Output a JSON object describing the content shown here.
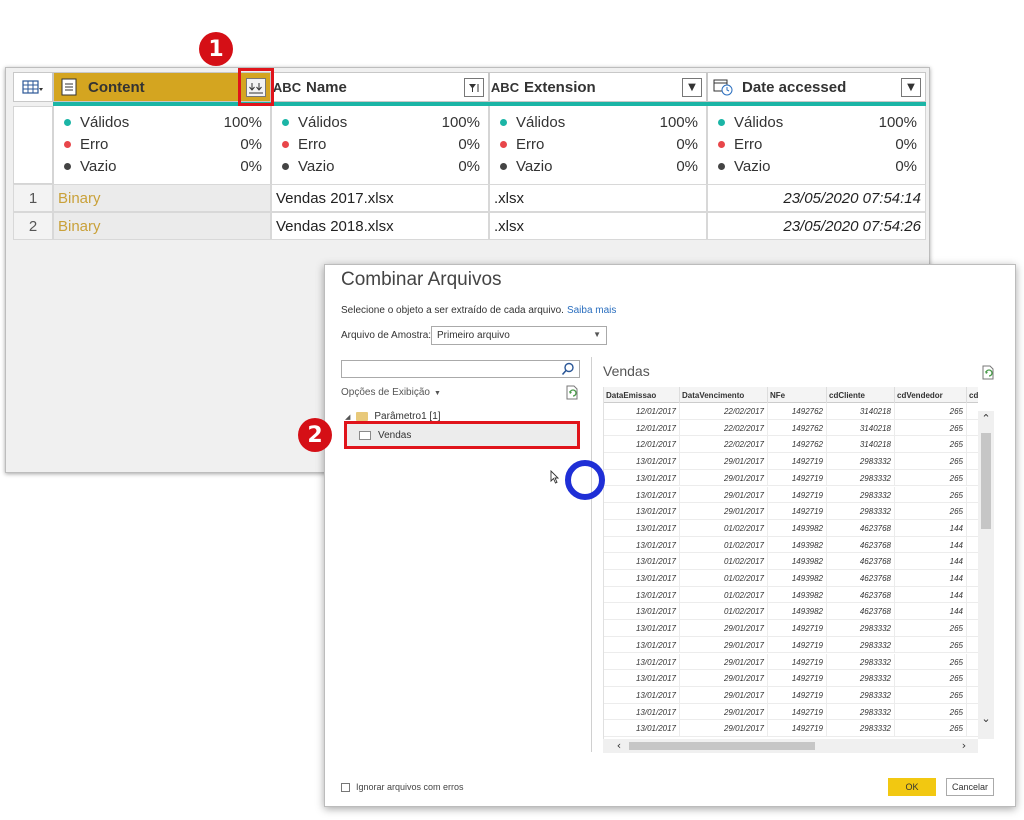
{
  "grid": {
    "columns": [
      {
        "name": "Content",
        "type_icon": "table-icon"
      },
      {
        "name": "Name",
        "type_icon": "ABC"
      },
      {
        "name": "Extension",
        "type_icon": "ABC"
      },
      {
        "name": "Date accessed",
        "type_icon": "date-icon"
      }
    ],
    "stats": {
      "valid_label": "Válidos",
      "error_label": "Erro",
      "empty_label": "Vazio",
      "valid_pct": "100%",
      "error_pct": "0%",
      "empty_pct": "0%"
    },
    "rows": [
      {
        "index": "1",
        "content": "Binary",
        "name": "Vendas 2017.xlsx",
        "extension": ".xlsx",
        "date": "23/05/2020 07:54:14"
      },
      {
        "index": "2",
        "content": "Binary",
        "name": "Vendas 2018.xlsx",
        "extension": ".xlsx",
        "date": "23/05/2020 07:54:26"
      }
    ],
    "colors": {
      "content_header": "#d4a520",
      "quality_bar": "#1bb5a6",
      "valid": "#1bb5a6",
      "error": "#e8464a",
      "empty": "#444444"
    }
  },
  "callouts": {
    "step1": "1",
    "step2": "2",
    "color": "#e0141b"
  },
  "dialog": {
    "title": "Combinar Arquivos",
    "description": "Selecione o objeto a ser extraído de cada arquivo.",
    "learn_more": "Saiba mais",
    "sample_label": "Arquivo de Amostra:",
    "sample_value": "Primeiro arquivo",
    "search_placeholder": "",
    "display_options": "Opções de Exibição",
    "tree": {
      "parameter": "Parâmetro1 [1]",
      "item": "Vendas"
    },
    "preview": {
      "title": "Vendas",
      "headers": [
        "DataEmissao",
        "DataVencimento",
        "NFe",
        "cdCliente",
        "cdVendedor",
        "cdProd"
      ],
      "rows": [
        [
          "12/01/2017",
          "22/02/2017",
          "1492762",
          "3140218",
          "265"
        ],
        [
          "12/01/2017",
          "22/02/2017",
          "1492762",
          "3140218",
          "265"
        ],
        [
          "12/01/2017",
          "22/02/2017",
          "1492762",
          "3140218",
          "265"
        ],
        [
          "13/01/2017",
          "29/01/2017",
          "1492719",
          "2983332",
          "265"
        ],
        [
          "13/01/2017",
          "29/01/2017",
          "1492719",
          "2983332",
          "265"
        ],
        [
          "13/01/2017",
          "29/01/2017",
          "1492719",
          "2983332",
          "265"
        ],
        [
          "13/01/2017",
          "29/01/2017",
          "1492719",
          "2983332",
          "265"
        ],
        [
          "13/01/2017",
          "01/02/2017",
          "1493982",
          "4623768",
          "144"
        ],
        [
          "13/01/2017",
          "01/02/2017",
          "1493982",
          "4623768",
          "144"
        ],
        [
          "13/01/2017",
          "01/02/2017",
          "1493982",
          "4623768",
          "144"
        ],
        [
          "13/01/2017",
          "01/02/2017",
          "1493982",
          "4623768",
          "144"
        ],
        [
          "13/01/2017",
          "01/02/2017",
          "1493982",
          "4623768",
          "144"
        ],
        [
          "13/01/2017",
          "01/02/2017",
          "1493982",
          "4623768",
          "144"
        ],
        [
          "13/01/2017",
          "29/01/2017",
          "1492719",
          "2983332",
          "265"
        ],
        [
          "13/01/2017",
          "29/01/2017",
          "1492719",
          "2983332",
          "265"
        ],
        [
          "13/01/2017",
          "29/01/2017",
          "1492719",
          "2983332",
          "265"
        ],
        [
          "13/01/2017",
          "29/01/2017",
          "1492719",
          "2983332",
          "265"
        ],
        [
          "13/01/2017",
          "29/01/2017",
          "1492719",
          "2983332",
          "265"
        ],
        [
          "13/01/2017",
          "29/01/2017",
          "1492719",
          "2983332",
          "265"
        ],
        [
          "13/01/2017",
          "29/01/2017",
          "1492719",
          "2983332",
          "265"
        ]
      ]
    },
    "ignore_errors": "Ignorar arquivos com erros",
    "ok": "OK",
    "cancel": "Cancelar",
    "accent": "#f2c811"
  }
}
